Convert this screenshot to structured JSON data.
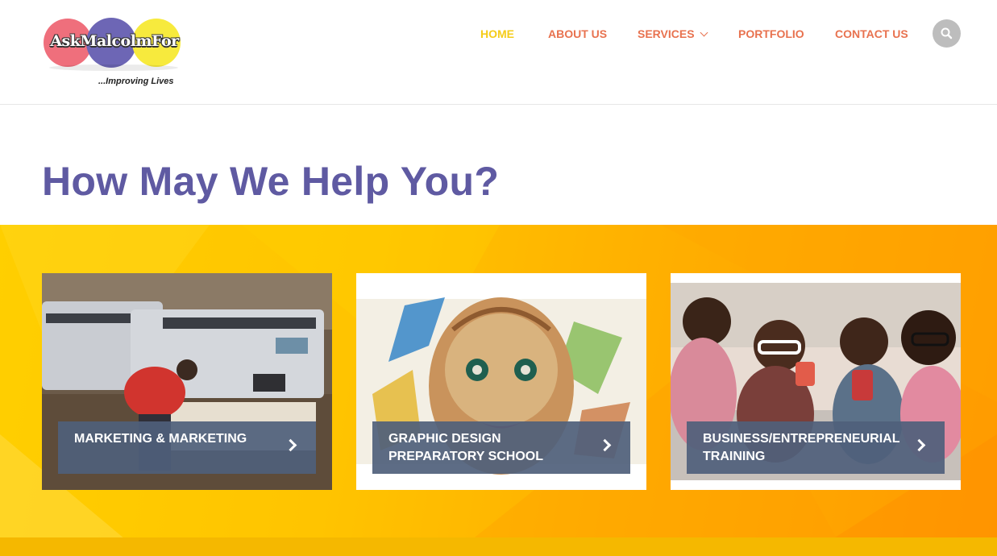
{
  "brand": {
    "name": "AskMalcolmFor",
    "tagline": "...Improving Lives",
    "circle_colors": [
      "#ef6f7c",
      "#6d66b5",
      "#f7ea3d"
    ]
  },
  "nav": {
    "items": [
      {
        "label": "HOME",
        "active": true
      },
      {
        "label": "ABOUT US",
        "active": false
      },
      {
        "label": "SERVICES",
        "active": false,
        "has_dropdown": true
      },
      {
        "label": "PORTFOLIO",
        "active": false
      },
      {
        "label": "CONTACT US",
        "active": false
      }
    ],
    "search_icon": "search-icon"
  },
  "main": {
    "heading": "How May We Help You?"
  },
  "services": [
    {
      "label": "MARKETING & MARKETING",
      "image": "printer-operator-photo"
    },
    {
      "label": "GRAPHIC DESIGN PREPARATORY SCHOOL",
      "image": "ornamental-face-artwork"
    },
    {
      "label": "BUSINESS/ENTREPRENEURIAL TRAINING",
      "image": "girls-with-glasses-photo"
    }
  ],
  "colors": {
    "heading": "#5f5aa2",
    "nav_link": "#e8724f",
    "nav_active": "#f5cc19",
    "band_start": "#ffcf00",
    "band_end": "#ff9a00",
    "card_overlay": "#4f607b"
  }
}
